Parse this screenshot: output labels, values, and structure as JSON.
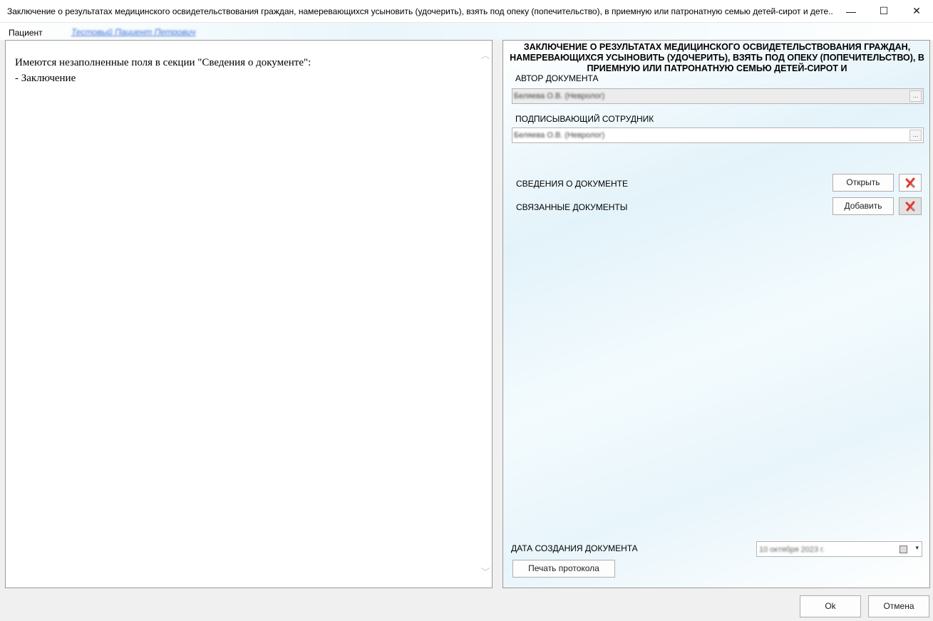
{
  "window": {
    "title": "Заключение о результатах медицинского освидетельствования граждан, намеревающихся усыновить (удочерить), взять под опеку (попечительство), в приемную или патронатную семью детей-сирот и дете...",
    "minimize_glyph": "—",
    "maximize_glyph": "☐",
    "close_glyph": "✕"
  },
  "menubar": {
    "patient_label": "Пациент",
    "patient_name": "Тестовый Пациент Петрович"
  },
  "left_panel": {
    "message_line1": "Имеются незаполненные поля в секции \"Сведения о документе\":",
    "message_line2": "- Заключение",
    "scroll_up_glyph": "︿",
    "scroll_down_glyph": "﹀"
  },
  "right_panel": {
    "doc_title": "ЗАКЛЮЧЕНИЕ О РЕЗУЛЬТАТАХ МЕДИЦИНСКОГО ОСВИДЕТЕЛЬСТВОВАНИЯ ГРАЖДАН, НАМЕРЕВАЮЩИХСЯ УСЫНОВИТЬ (УДОЧЕРИТЬ), ВЗЯТЬ ПОД ОПЕКУ (ПОПЕЧИТЕЛЬСТВО), В ПРИЕМНУЮ ИЛИ ПАТРОНАТНУЮ СЕМЬЮ ДЕТЕЙ-СИРОТ И",
    "author_label": "АВТОР ДОКУМЕНТА",
    "author_value": "Беляева О.В. (Невролог)",
    "signer_label": "ПОДПИСЫВАЮЩИЙ СОТРУДНИК",
    "signer_value": "Беляева О.В. (Невролог)",
    "dots_glyph": "...",
    "doc_info_label": "СВЕДЕНИЯ О ДОКУМЕНТЕ",
    "open_button": "Открыть",
    "related_docs_label": "СВЯЗАННЫЕ ДОКУМЕНТЫ",
    "add_button": "Добавить",
    "creation_date_label": "ДАТА СОЗДАНИЯ ДОКУМЕНТА",
    "creation_date_value": "10 октября 2023 г.",
    "print_button": "Печать протокола",
    "dropdown_glyph": "▾"
  },
  "footer": {
    "ok_button": "Ok",
    "cancel_button": "Отмена"
  },
  "colors": {
    "accent_link": "#3b6fd6",
    "delete_icon_red": "#e03c31"
  }
}
